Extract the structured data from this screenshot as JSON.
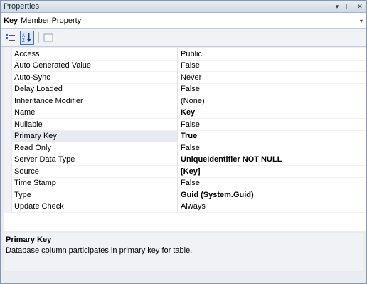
{
  "window": {
    "title": "Properties"
  },
  "titlebar": {
    "dropdown_glyph": "▾",
    "pin_glyph": "⊢",
    "close_glyph": "✕"
  },
  "selector": {
    "key": "Key",
    "type": "Member Property",
    "arrow": "▾"
  },
  "toolbar": {
    "buttons": [
      {
        "name": "categorized-icon",
        "active": false
      },
      {
        "name": "alphabetical-icon",
        "active": true
      },
      {
        "name": "property-pages-icon",
        "active": false
      }
    ]
  },
  "properties": [
    {
      "name": "Access",
      "value": "Public",
      "bold": false
    },
    {
      "name": "Auto Generated Value",
      "value": "False",
      "bold": false
    },
    {
      "name": "Auto-Sync",
      "value": "Never",
      "bold": false
    },
    {
      "name": "Delay Loaded",
      "value": "False",
      "bold": false
    },
    {
      "name": "Inheritance Modifier",
      "value": "(None)",
      "bold": false
    },
    {
      "name": "Name",
      "value": "Key",
      "bold": true
    },
    {
      "name": "Nullable",
      "value": "False",
      "bold": false
    },
    {
      "name": "Primary Key",
      "value": "True",
      "bold": true,
      "selected": true
    },
    {
      "name": "Read Only",
      "value": "False",
      "bold": false
    },
    {
      "name": "Server Data Type",
      "value": "UniqueIdentifier NOT NULL",
      "bold": true
    },
    {
      "name": "Source",
      "value": "[Key]",
      "bold": true
    },
    {
      "name": "Time Stamp",
      "value": "False",
      "bold": false
    },
    {
      "name": "Type",
      "value": "Guid (System.Guid)",
      "bold": true
    },
    {
      "name": "Update Check",
      "value": "Always",
      "bold": false
    }
  ],
  "description": {
    "title": "Primary Key",
    "text": "Database column participates in primary key for table."
  }
}
